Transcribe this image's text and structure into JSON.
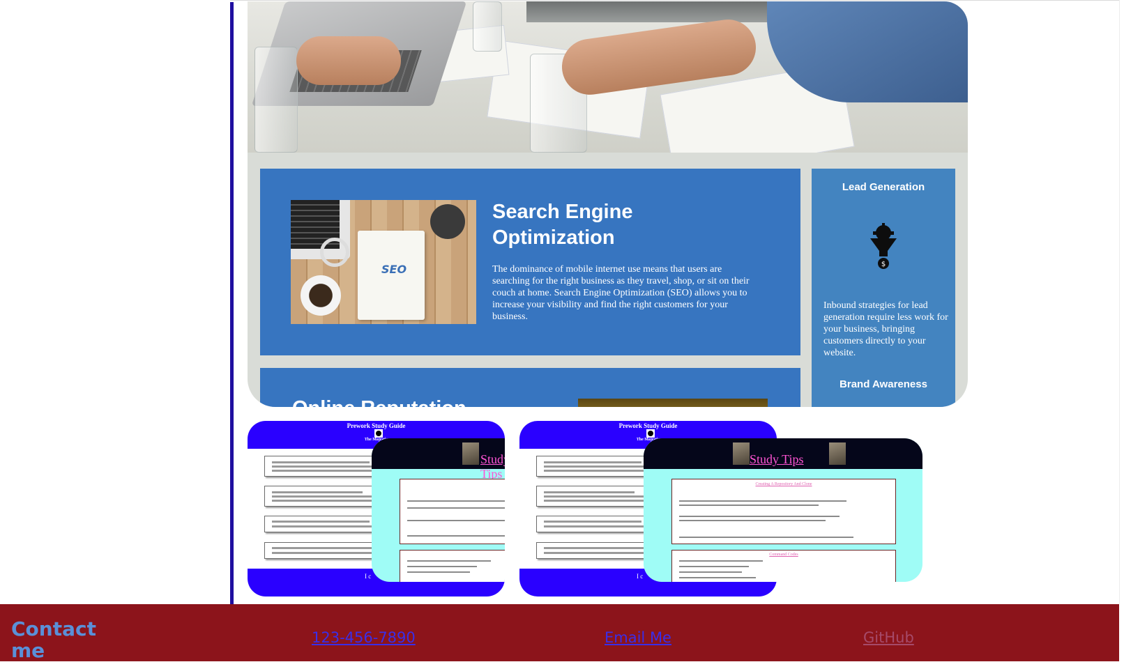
{
  "agency_card": {
    "seo": {
      "title": "Search Engine Optimization",
      "text": "The dominance of mobile internet use means that users are searching for the right business as they travel, shop, or sit on their couch at home. Search Engine Optimization (SEO) allows you to increase your visibility and find the right customers for your business.",
      "image_tag": "SEO"
    },
    "lead": {
      "title": "Lead Generation",
      "text": "Inbound strategies for lead generation require less work for your business, bringing customers directly to your website.",
      "icon": "funnel-gear-dollar-icon"
    },
    "brand": {
      "title": "Brand Awareness"
    },
    "online": {
      "title": "Online Reputation"
    }
  },
  "guides": [
    {
      "title": "Prework Study Guide",
      "subtitle": "The Majestic",
      "footer": "I c",
      "tips_title": "Study Tips"
    },
    {
      "title": "Prework Study Guide",
      "subtitle": "The Majestic",
      "footer": "I c",
      "tips_title": "Study Tips",
      "tips_h1": "Creating A Repository And Clone",
      "tips_h2": "Command Codes"
    }
  ],
  "footer": {
    "title": "Contact me",
    "phone": "123-456-7890",
    "email": "Email Me",
    "github": "GitHub"
  },
  "colors": {
    "sidebar_line": "#1f0fa0",
    "footer_bg": "#8c141b",
    "footer_title": "#5a90d8",
    "link": "#3a2ee8",
    "visited_link": "#a64a6a",
    "seo_blue": "#3775c0",
    "lead_blue": "#4384c0",
    "guide_blue": "#2a00ff",
    "tips_cyan": "#9ffcf6"
  }
}
